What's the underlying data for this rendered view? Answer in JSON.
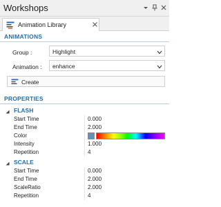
{
  "window": {
    "title": "Workshops",
    "controls": [
      "pin-dropdown-icon",
      "pin-icon",
      "close-icon"
    ]
  },
  "tab": {
    "label": "Animation Library",
    "icon": "library-icon"
  },
  "animations": {
    "header": "ANIMATIONS",
    "group_label": "Group :",
    "group_value": "Highlight",
    "animation_label": "Animation :",
    "animation_value": "enhance",
    "create_label": "Create"
  },
  "properties": {
    "header": "PROPERTIES",
    "categories": [
      {
        "name": "FLASH",
        "rows": [
          {
            "name": "Start Time",
            "value": "0.000"
          },
          {
            "name": "End Time",
            "value": "2.000"
          },
          {
            "name": "Color",
            "value": ""
          },
          {
            "name": "Intensity",
            "value": "1.000"
          },
          {
            "name": "Repetition",
            "value": "4"
          }
        ]
      },
      {
        "name": "SCALE",
        "rows": [
          {
            "name": "Start Time",
            "value": "0.000"
          },
          {
            "name": "End Time",
            "value": "2.000"
          },
          {
            "name": "ScaleRatio",
            "value": "2.000"
          },
          {
            "name": "Repetition",
            "value": "4"
          }
        ]
      }
    ]
  },
  "colors": {
    "accent": "#1f6fb5",
    "color_swatch": "#6a8fb5"
  }
}
